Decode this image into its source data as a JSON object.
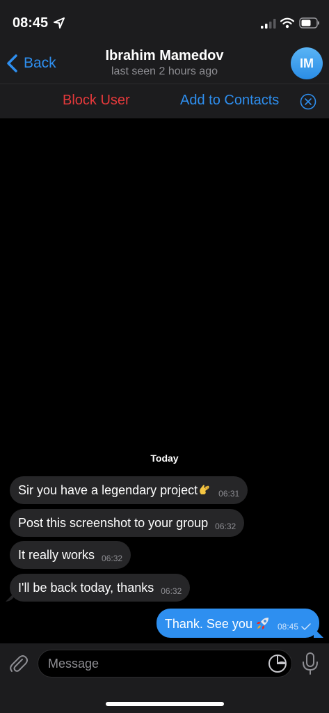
{
  "status_bar": {
    "time": "08:45"
  },
  "header": {
    "back_label": "Back",
    "contact_name": "Ibrahim Mamedov",
    "contact_status": "last seen 2 hours ago",
    "avatar_initials": "IM"
  },
  "actions": {
    "block_label": "Block User",
    "add_contact_label": "Add to Contacts"
  },
  "chat": {
    "date_label": "Today",
    "messages": [
      {
        "text": "Sir you have a legendary project",
        "time": "06:31",
        "direction": "incoming",
        "emoji": "ok-hand-emoji"
      },
      {
        "text": "Post this screenshot to your group",
        "time": "06:32",
        "direction": "incoming"
      },
      {
        "text": "It really works",
        "time": "06:32",
        "direction": "incoming"
      },
      {
        "text": "I'll be back today, thanks",
        "time": "06:32",
        "direction": "incoming"
      },
      {
        "text": "Thank. See you",
        "time": "08:45",
        "direction": "outgoing",
        "emoji": "rocket-emoji",
        "status": "sent-check"
      }
    ]
  },
  "input": {
    "placeholder": "Message"
  },
  "colors": {
    "accent": "#2e8ff0",
    "danger": "#e5393b",
    "incoming_bubble": "#262628",
    "outgoing_bubble": "#2e8ff0",
    "bar_background": "#1c1c1e"
  }
}
